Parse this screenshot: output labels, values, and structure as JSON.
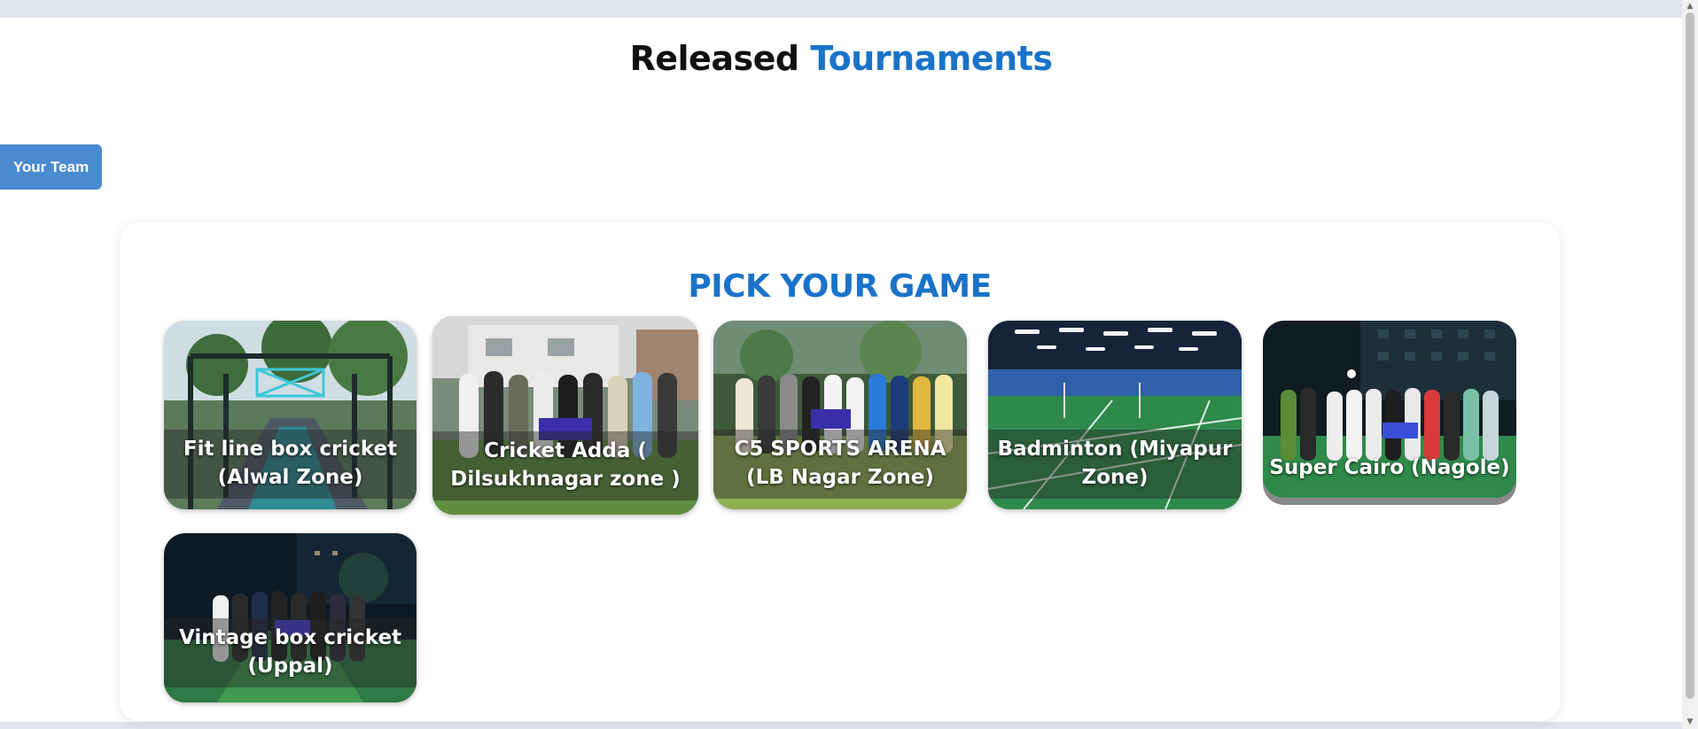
{
  "page": {
    "title_part1": "Released",
    "title_part2": "Tournaments"
  },
  "sidebar": {
    "team_button_label": "Your Team"
  },
  "picker": {
    "title": "PICK YOUR GAME",
    "cards": [
      {
        "label": "Fit line box cricket (Alwal Zone)",
        "scene": "cricket-net-outdoor"
      },
      {
        "label": "Cricket Adda ( Dilsukhnagar zone )",
        "scene": "team-photo-day"
      },
      {
        "label": "C5 SPORTS ARENA (LB Nagar Zone)",
        "scene": "team-photo-turf"
      },
      {
        "label": "Badminton (Miyapur Zone)",
        "scene": "badminton-hall"
      },
      {
        "label": "Super Cairo (Nagole)",
        "scene": "team-photo-night"
      },
      {
        "label": "Vintage box cricket (Uppal)",
        "scene": "team-photo-night-turf"
      }
    ]
  },
  "colors": {
    "accent": "#1a73c9",
    "button": "#4a8bd0"
  }
}
